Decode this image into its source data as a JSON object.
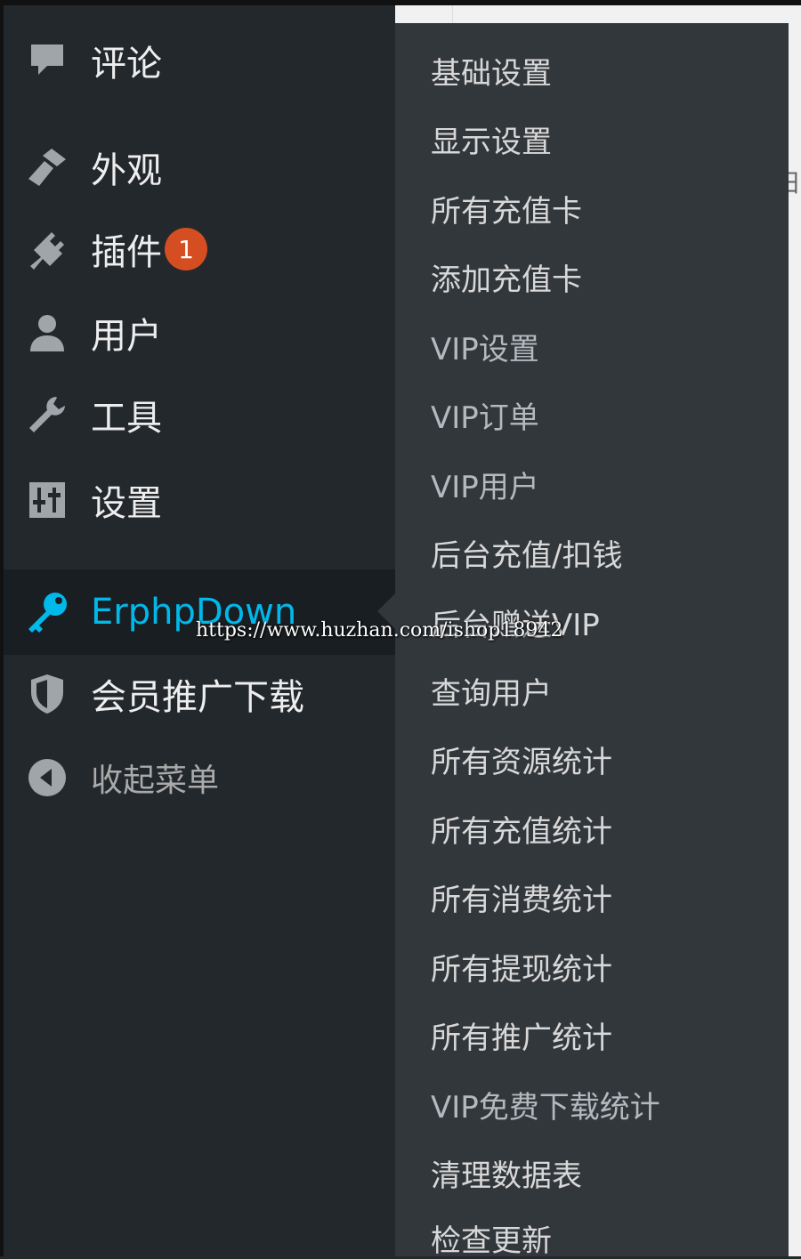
{
  "colors": {
    "sidebar_bg": "#23282d",
    "submenu_bg": "#32373c",
    "current_bg": "#191e23",
    "accent": "#00b9eb",
    "badge": "#d54e21"
  },
  "menu": [
    {
      "label": "评论",
      "icon": "comment-icon"
    },
    {
      "label": "外观",
      "icon": "paintbrush-icon"
    },
    {
      "label": "插件",
      "icon": "plugin-icon",
      "badge": "1"
    },
    {
      "label": "用户",
      "icon": "user-icon"
    },
    {
      "label": "工具",
      "icon": "wrench-icon"
    },
    {
      "label": "设置",
      "icon": "settings-icon"
    },
    {
      "label": "ErphpDown",
      "icon": "key-icon",
      "current": true
    },
    {
      "label": "会员推广下载",
      "icon": "shield-icon"
    },
    {
      "label": "收起菜单",
      "icon": "collapse-icon"
    }
  ],
  "submenu": [
    "基础设置",
    "显示设置",
    "所有充值卡",
    "添加充值卡",
    "VIP设置",
    "VIP订单",
    "VIP用户",
    "后台充值/扣钱",
    "后台赠送VIP",
    "查询用户",
    "所有资源统计",
    "所有充值统计",
    "所有消费统计",
    "所有提现统计",
    "所有推广统计",
    "VIP免费下载统计",
    "清理数据表",
    "检查更新"
  ],
  "watermark": "https://www.huzhan.com/ishop18942",
  "background_fragment": "田"
}
